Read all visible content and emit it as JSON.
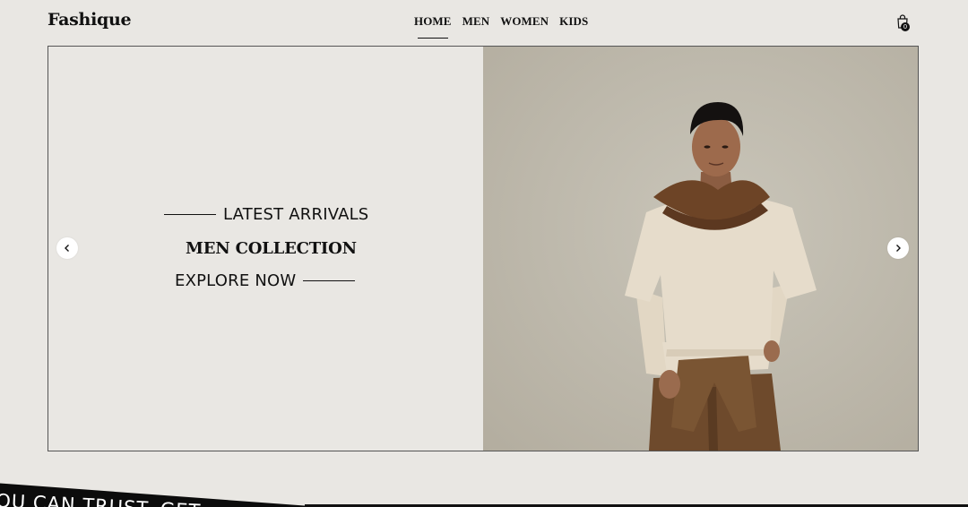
{
  "brand": {
    "logo": "Fashique"
  },
  "nav": {
    "items": [
      {
        "label": "HOME",
        "active": true
      },
      {
        "label": "MEN",
        "active": false
      },
      {
        "label": "WOMEN",
        "active": false
      },
      {
        "label": "KIDS",
        "active": false
      }
    ]
  },
  "cart": {
    "count": "0",
    "icon": "shopping-bag-icon"
  },
  "hero": {
    "kicker": "LATEST ARRIVALS",
    "title": "MEN COLLECTION",
    "cta": "EXPLORE NOW",
    "prev_icon": "chevron-left-icon",
    "next_icon": "chevron-right-icon"
  },
  "ticker": {
    "text": "OU CAN TRUST. GET"
  },
  "colors": {
    "background": "#e9e7e3",
    "ink": "#111111",
    "photo_bg": "#bdb8ab"
  }
}
